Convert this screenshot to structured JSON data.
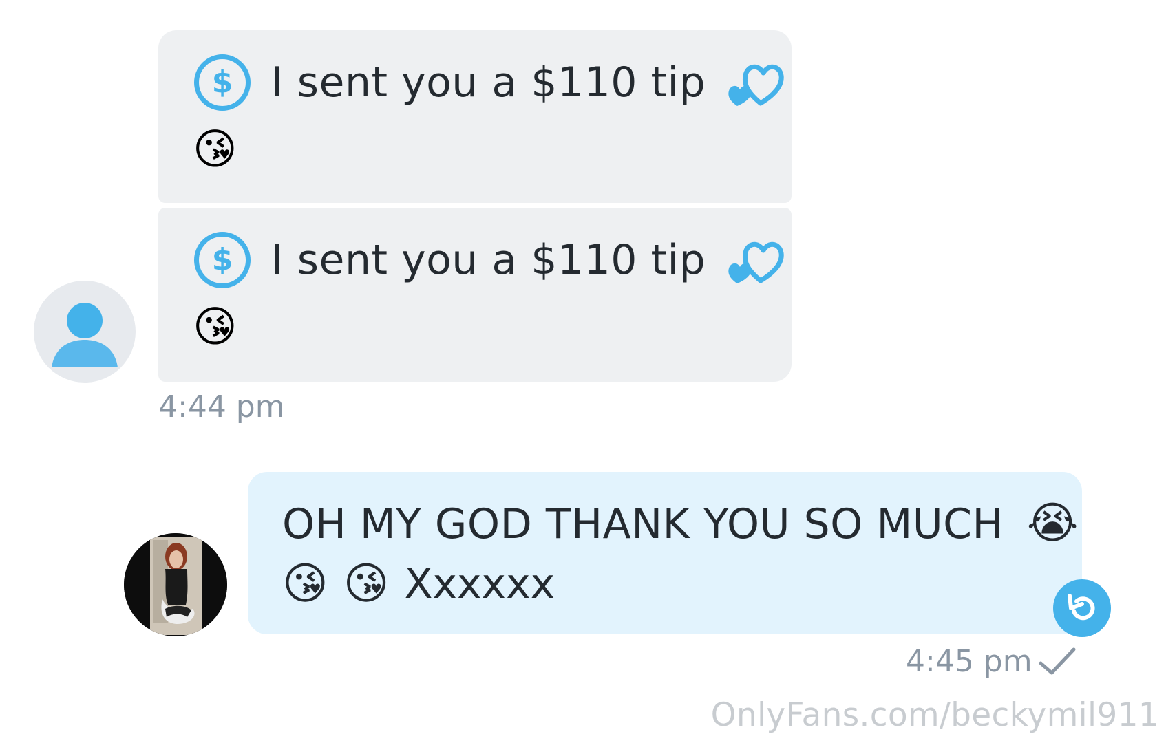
{
  "incoming": {
    "messages": [
      {
        "tip_text": "I sent you a $110 tip",
        "emoji": "😘",
        "dollar_symbol": "$"
      },
      {
        "tip_text": "I sent you a $110 tip",
        "emoji": "😘",
        "dollar_symbol": "$"
      }
    ],
    "timestamp": "4:44 pm"
  },
  "outgoing": {
    "line1_text": "OH MY GOD THANK YOU SO MUCH",
    "line1_emoji": "😭",
    "line2_emoji_1": "😘",
    "line2_emoji_2": "😘",
    "line2_text": "Xxxxxx",
    "timestamp": "4:45 pm"
  },
  "watermark": "OnlyFans.com/beckymil911",
  "icons": {
    "tip": "dollar-circle-icon",
    "hearts": "two-hearts-icon",
    "default_avatar": "user-silhouette-icon",
    "undo": "undo-icon",
    "read": "checkmark-icon"
  },
  "colors": {
    "accent": "#44b2ea",
    "incoming_bubble": "#eef0f2",
    "outgoing_bubble": "#e2f3fd",
    "timestamp": "#8a96a3",
    "watermark": "#c8ccd0"
  }
}
